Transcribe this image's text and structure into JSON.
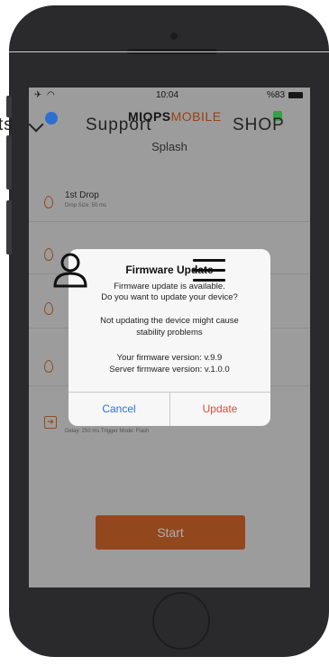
{
  "status_bar": {
    "time": "10:04",
    "battery": "%83"
  },
  "app": {
    "brand_part1": "MIOPS",
    "brand_part2": "MOBILE",
    "page_title": "Splash",
    "rows": [
      {
        "title": "1st Drop",
        "subtitle": "Drop Size: 50 ms"
      },
      {
        "title": "",
        "subtitle": ""
      },
      {
        "title": "",
        "subtitle": ""
      },
      {
        "title": "",
        "subtitle": ""
      },
      {
        "title": "",
        "subtitle": "Delay: 250 ms    Trigger Mode: Flash"
      }
    ],
    "start_label": "Start"
  },
  "dialog": {
    "title": "Firmware Update",
    "line1": "Firmware update is available.",
    "line2": "Do you want to update your device?",
    "line3": "Not updating the device might cause",
    "line4": "stability problems",
    "line5": "Your firmware version: v.9.9",
    "line6": "Server firmware version: v.1.0.0",
    "cancel_label": "Cancel",
    "update_label": "Update"
  },
  "site_nav": {
    "item_partial": "ts",
    "support": "Support",
    "shop": "SHOP"
  },
  "colors": {
    "accent": "#d9692c",
    "ios_blue": "#2f6fd9",
    "ios_red": "#e04a3a",
    "phone_body": "#2a2a2c"
  }
}
